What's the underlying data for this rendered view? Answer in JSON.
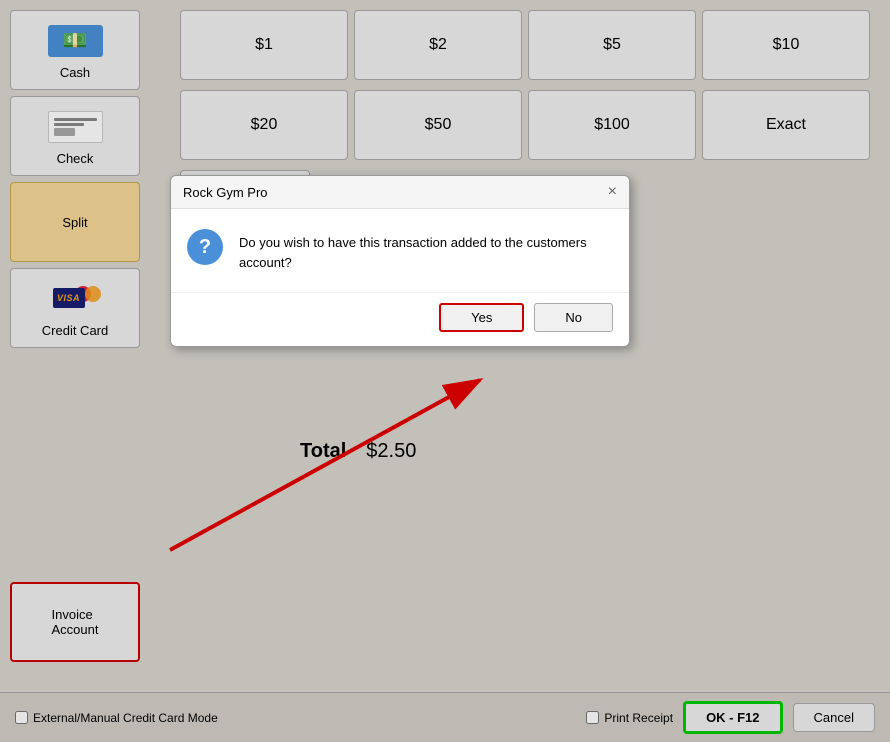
{
  "payment_methods": {
    "cash": {
      "label": "Cash"
    },
    "check": {
      "label": "Check"
    },
    "split": {
      "label": "Split"
    },
    "credit_card": {
      "label": "Credit Card"
    }
  },
  "invoice_account": {
    "label": "Invoice\nAccount"
  },
  "denominations_row1": [
    {
      "label": "$1"
    },
    {
      "label": "$2"
    },
    {
      "label": "$5"
    },
    {
      "label": "$10"
    }
  ],
  "denominations_row2": [
    {
      "label": "$20"
    },
    {
      "label": "$50"
    },
    {
      "label": "$100"
    },
    {
      "label": "Exact"
    }
  ],
  "credit_card_label": "Credit Card",
  "total": {
    "label": "Total",
    "value": "$2.50"
  },
  "bottom": {
    "external_mode_label": "External/Manual Credit Card Mode",
    "print_receipt_label": "Print Receipt",
    "ok_button": "OK - F12",
    "cancel_button": "Cancel"
  },
  "modal": {
    "title": "Rock Gym Pro",
    "message": "Do you wish to have this transaction added to the customers account?",
    "yes_label": "Yes",
    "no_label": "No",
    "close_icon": "×"
  }
}
